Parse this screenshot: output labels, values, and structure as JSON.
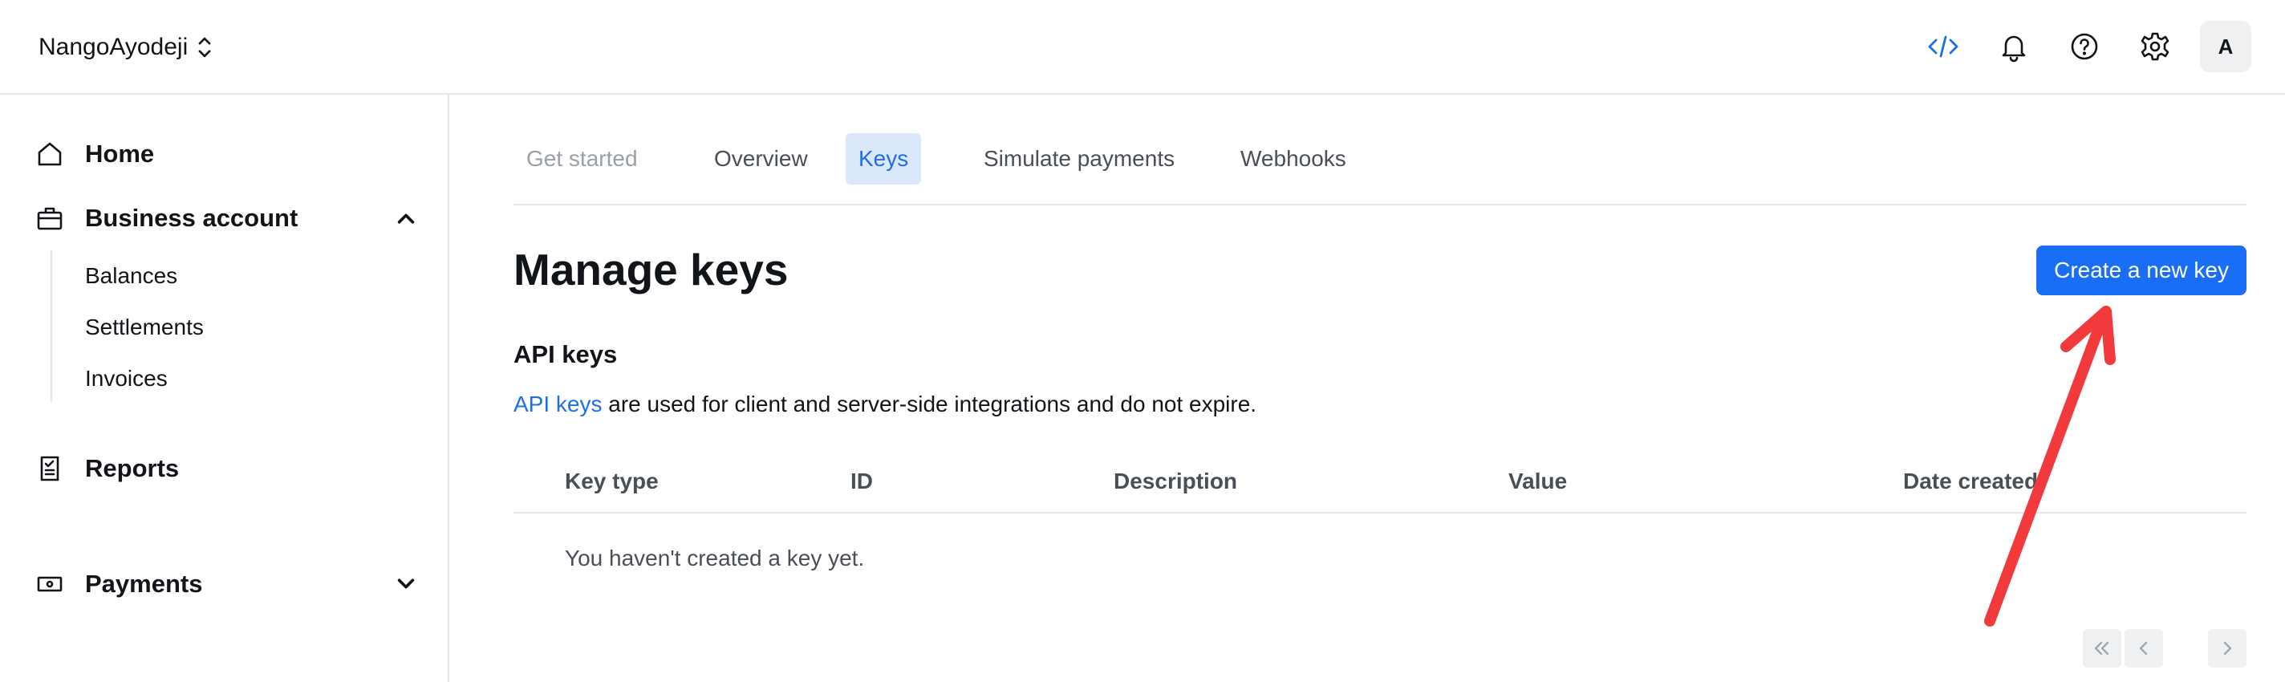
{
  "header": {
    "org_name": "NangoAyodeji",
    "avatar_initial": "A"
  },
  "sidebar": {
    "home": "Home",
    "business_account": "Business account",
    "business_items": [
      "Balances",
      "Settlements",
      "Invoices"
    ],
    "reports": "Reports",
    "payments": "Payments"
  },
  "tabs": [
    {
      "label": "Get started",
      "state": "muted"
    },
    {
      "label": "Overview",
      "state": "normal"
    },
    {
      "label": "Keys",
      "state": "active"
    },
    {
      "label": "Simulate payments",
      "state": "normal"
    },
    {
      "label": "Webhooks",
      "state": "normal"
    }
  ],
  "main": {
    "title": "Manage keys",
    "create_button": "Create a new key",
    "section_title": "API keys",
    "desc_link": "API keys",
    "desc_rest": " are used for client and server-side integrations and do not expire.",
    "columns": [
      "Key type",
      "ID",
      "Description",
      "Value",
      "Date created"
    ],
    "empty_message": "You haven't created a key yet."
  },
  "colors": {
    "accent": "#1a6ef5",
    "active_tab_bg": "#dbe8fb",
    "annotation_arrow": "#f23a3c"
  }
}
